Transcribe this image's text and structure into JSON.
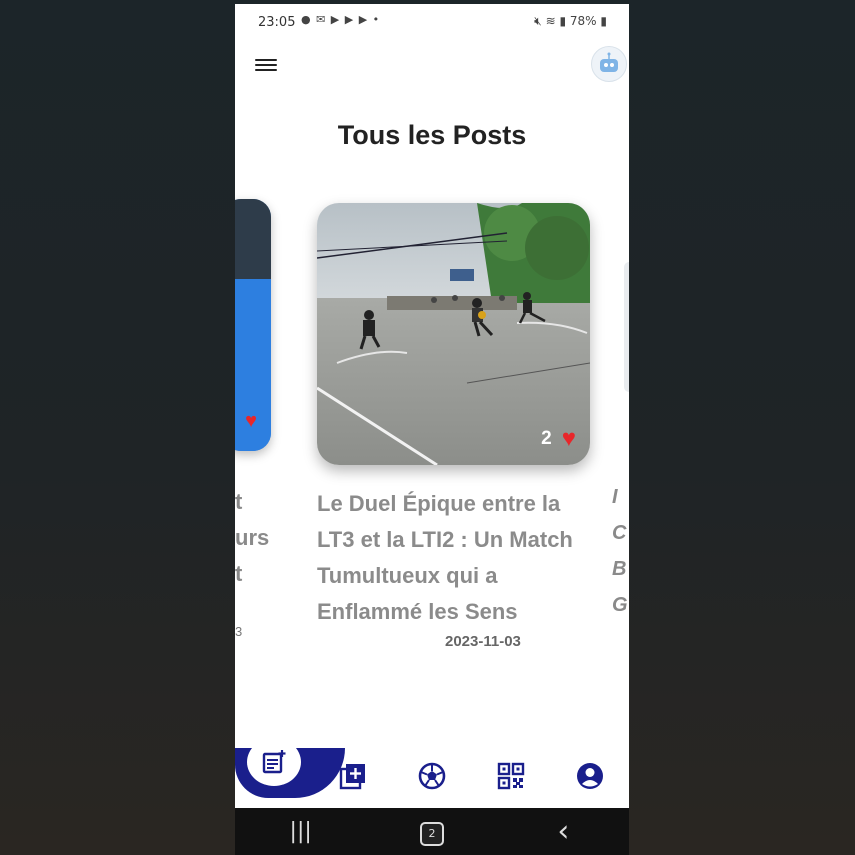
{
  "status_bar": {
    "time": "23:05",
    "notification_icons": "● ✉ ▶ ▶ ▶ •",
    "battery": "78%"
  },
  "page": {
    "title": "Tous les Posts"
  },
  "posts": [
    {
      "title": "Le Duel Épique entre la LT3 et la LTI2 : Un Match Tumultueux qui a Enflammé les Sens",
      "date": "2023-11-03",
      "likes": "2"
    }
  ],
  "side_posts": {
    "left_fragment": "t\nurs\nt",
    "left_date_fragment": "3",
    "right_fragment": "I\nC\nB\nG"
  },
  "bottom_nav": {
    "items": [
      "posts-icon",
      "add-post-icon",
      "football-icon",
      "qr-code-icon",
      "profile-icon"
    ],
    "active": "posts-icon"
  },
  "system_nav": {
    "recents": "|||",
    "home_badge": "2",
    "back": "‹"
  },
  "colors": {
    "accent": "#1a1f8c",
    "heart": "#e8262a"
  }
}
